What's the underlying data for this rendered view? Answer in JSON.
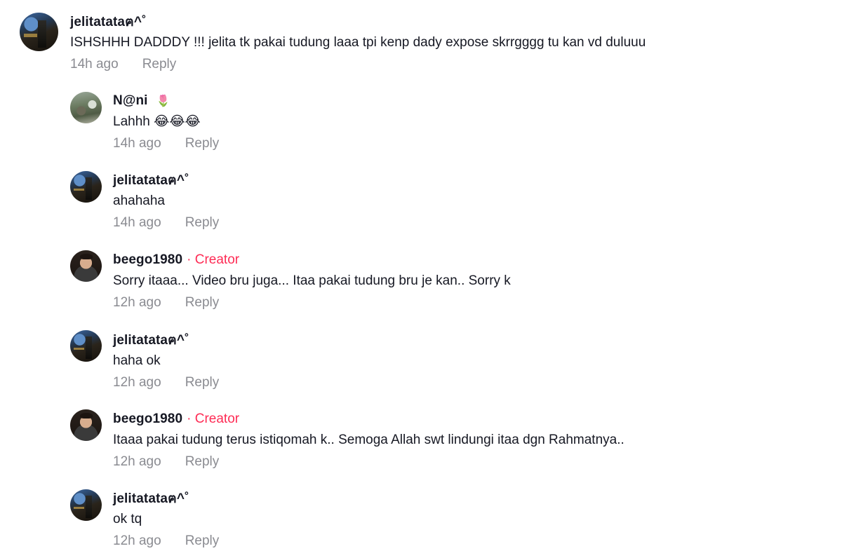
{
  "comments": [
    {
      "username": "jelitatataฅ^˚",
      "text": "ISHSHHH DADDDY !!! jelita tk pakai tudung laaa tpi kenp dady expose skrrgggg tu kan vd duluuu",
      "time": "14h ago",
      "reply_label": "Reply",
      "avatar": "jelitatata-avatar"
    }
  ],
  "replies": [
    {
      "username": "N@ni",
      "emoji": "🌷",
      "text": "Lahhh 😂😂😂",
      "time": "14h ago",
      "reply_label": "Reply",
      "avatar": "nani-avatar"
    },
    {
      "username": "jelitatataฅ^˚",
      "text": "ahahaha",
      "time": "14h ago",
      "reply_label": "Reply",
      "avatar": "jelitatata-avatar"
    },
    {
      "username": "beego1980",
      "badge": "· Creator",
      "text": "Sorry itaaa... Video bru juga... Itaa pakai tudung bru je kan.. Sorry k",
      "time": "12h ago",
      "reply_label": "Reply",
      "avatar": "beego-avatar"
    },
    {
      "username": "jelitatataฅ^˚",
      "text": "haha ok",
      "time": "12h ago",
      "reply_label": "Reply",
      "avatar": "jelitatata-avatar"
    },
    {
      "username": "beego1980",
      "badge": "· Creator",
      "text": "Itaaa pakai tudung terus istiqomah k.. Semoga Allah swt lindungi itaa dgn Rahmatnya..",
      "time": "12h ago",
      "reply_label": "Reply",
      "avatar": "beego-avatar"
    },
    {
      "username": "jelitatataฅ^˚",
      "text": "ok tq",
      "time": "12h ago",
      "reply_label": "Reply",
      "avatar": "jelitatata-avatar"
    }
  ],
  "colors": {
    "creator_badge": "#fe2c55",
    "meta_text": "#8a8b91",
    "primary_text": "#161823"
  }
}
